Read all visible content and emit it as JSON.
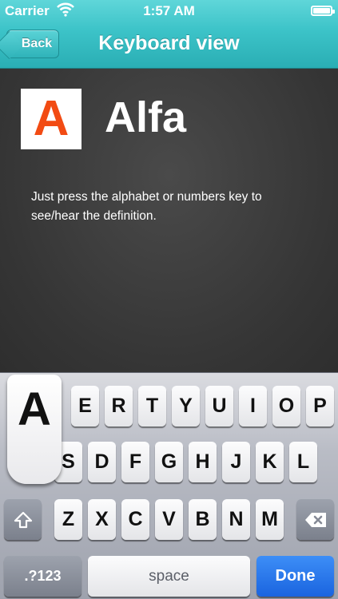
{
  "status_bar": {
    "carrier": "Carrier",
    "time": "1:57 AM"
  },
  "nav": {
    "back_label": "Back",
    "title": "Keyboard view"
  },
  "content": {
    "letter": "A",
    "word": "Alfa",
    "hint": "Just press the alphabet or numbers key to see/hear the definition."
  },
  "keyboard": {
    "popup_key": "A",
    "row1": [
      "E",
      "R",
      "T",
      "Y",
      "U",
      "I",
      "O",
      "P"
    ],
    "row2": [
      "S",
      "D",
      "F",
      "G",
      "H",
      "J",
      "K",
      "L"
    ],
    "row3": [
      "Z",
      "X",
      "C",
      "V",
      "B",
      "N",
      "M"
    ],
    "numbers_label": ".?123",
    "space_label": "space",
    "done_label": "Done"
  },
  "colors": {
    "accent": "#3cc3c8",
    "letter": "#f24b13",
    "done": "#1a64df"
  }
}
